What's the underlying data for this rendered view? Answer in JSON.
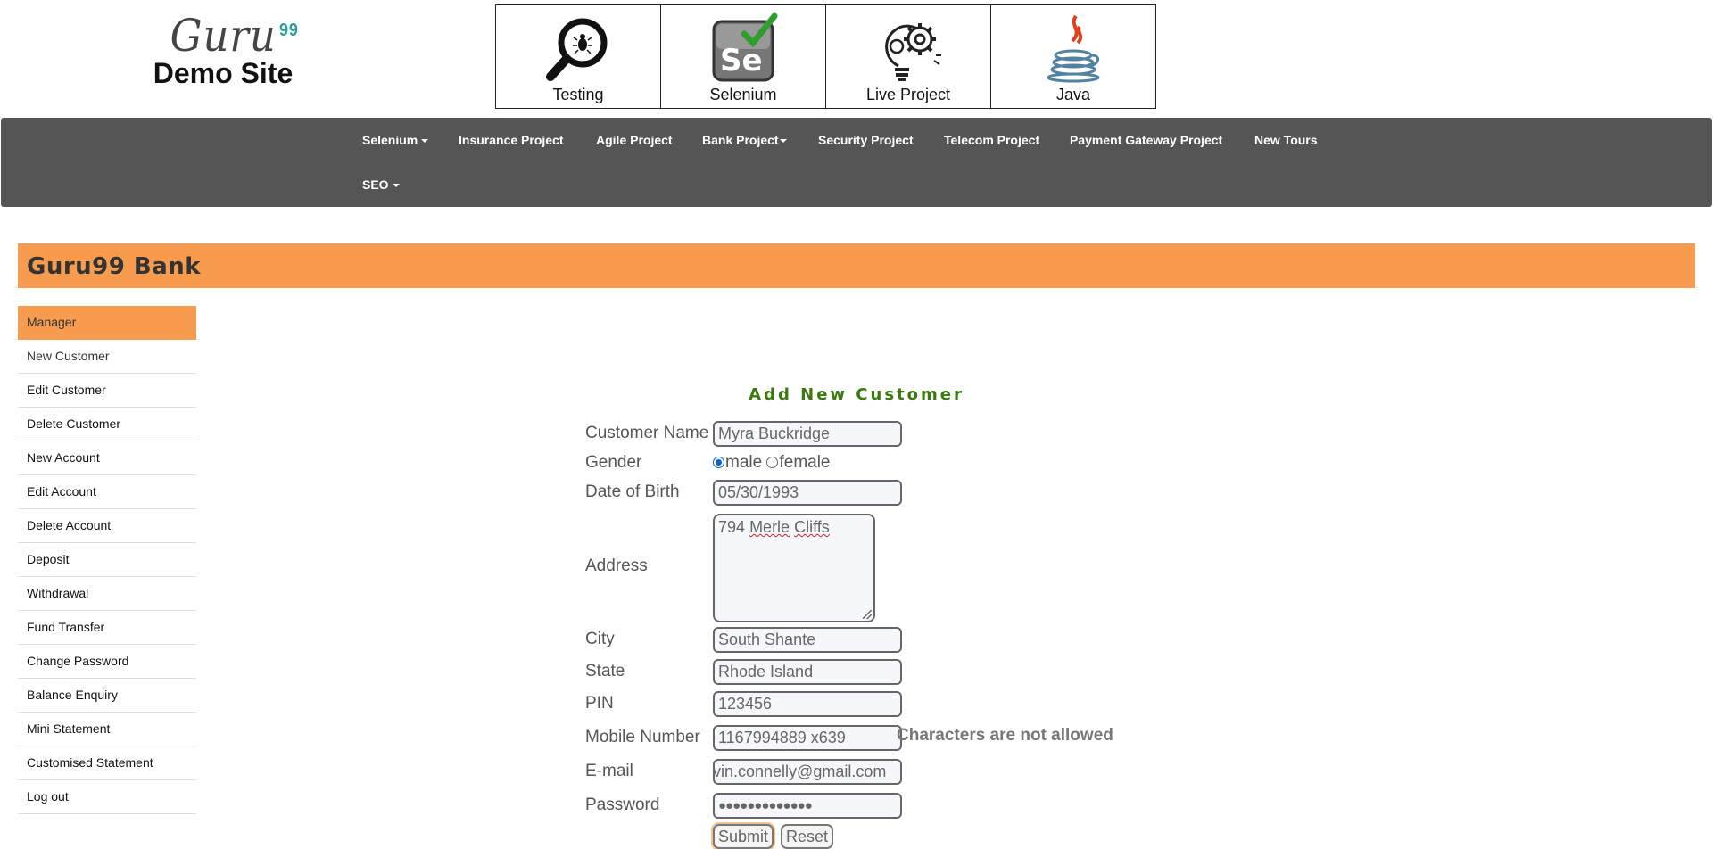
{
  "logo": {
    "brand": "Guru",
    "sup": "99",
    "site": "Demo Site"
  },
  "tiles": [
    {
      "label": "Testing",
      "icon": "magnifier-bug-icon"
    },
    {
      "label": "Selenium",
      "icon": "selenium-icon"
    },
    {
      "label": "Live Project",
      "icon": "gear-bulb-icon"
    },
    {
      "label": "Java",
      "icon": "java-cup-icon"
    }
  ],
  "nav": {
    "items": [
      "Selenium",
      "Insurance Project",
      "Agile Project",
      "Bank Project",
      "Security Project",
      "Telecom Project",
      "Payment Gateway Project",
      "New Tours",
      "SEO"
    ]
  },
  "bank": {
    "title": "Guru99 Bank"
  },
  "sidebar": {
    "items": [
      "Manager",
      "New Customer",
      "Edit Customer",
      "Delete Customer",
      "New Account",
      "Edit Account",
      "Delete Account",
      "Deposit",
      "Withdrawal",
      "Fund Transfer",
      "Change Password",
      "Balance Enquiry",
      "Mini Statement",
      "Customised Statement",
      "Log out"
    ]
  },
  "form": {
    "title": "Add New Customer",
    "labels": {
      "name": "Customer Name",
      "gender": "Gender",
      "dob": "Date of Birth",
      "address": "Address",
      "city": "City",
      "state": "State",
      "pin": "PIN",
      "mobile": "Mobile Number",
      "email": "E-mail",
      "password": "Password"
    },
    "values": {
      "name": "Myra Buckridge",
      "dob": "05/30/1993",
      "address_num": "794",
      "address_word1": "Merle",
      "address_word2": "Cliffs",
      "city": "South Shante",
      "state": "Rhode Island",
      "pin": "123456",
      "mobile": "1167994889 x639",
      "email": "vin.connelly@gmail.com",
      "password": "●●●●●●●●●●●●●"
    },
    "gender_options": [
      "male",
      "female"
    ],
    "gender_selected": "male",
    "mobile_error": "Characters are not allowed",
    "submit": "Submit",
    "reset": "Reset"
  },
  "colors": {
    "nav_bg": "#555555",
    "accent_orange": "#f79c4f",
    "title_green": "#3c7a10"
  }
}
